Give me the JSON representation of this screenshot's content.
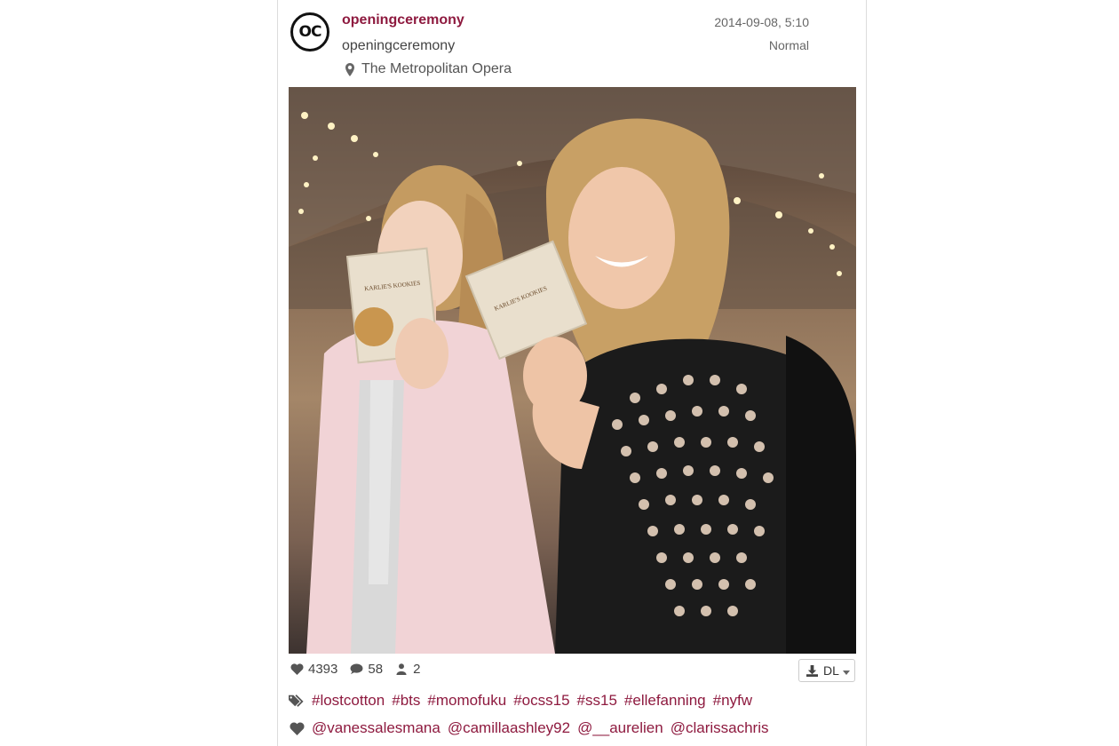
{
  "post": {
    "avatar_text": "OC",
    "username": "openingceremony",
    "full_name": "openingceremony",
    "location": "The Metropolitan Opera",
    "timestamp": "2014-09-08, 5:10",
    "filter": "Normal"
  },
  "stats": {
    "likes": "4393",
    "comments": "58",
    "tagged_users": "2"
  },
  "download_button": {
    "label": "DL"
  },
  "hashtags": [
    "#lostcotton",
    "#bts",
    "#momofuku",
    "#ocss15",
    "#ss15",
    "#ellefanning",
    "#nyfw"
  ],
  "mentions": [
    "@vanessalesmana",
    "@camillaashley92",
    "@__aurelien",
    "@clarissachris"
  ],
  "photo": {
    "packet_text": "KARLIE'S KOOKIES"
  },
  "icons": {
    "location": "map-marker-icon",
    "likes": "heart-icon",
    "comments": "comment-icon",
    "users": "user-icon",
    "download": "download-icon",
    "caret": "caret-down-icon",
    "tags": "tags-icon",
    "mentions": "heart-icon"
  },
  "colors": {
    "accent": "#8e1a3f",
    "coat": "#f1d3d6",
    "mesh_top": "#1b1b1b"
  }
}
